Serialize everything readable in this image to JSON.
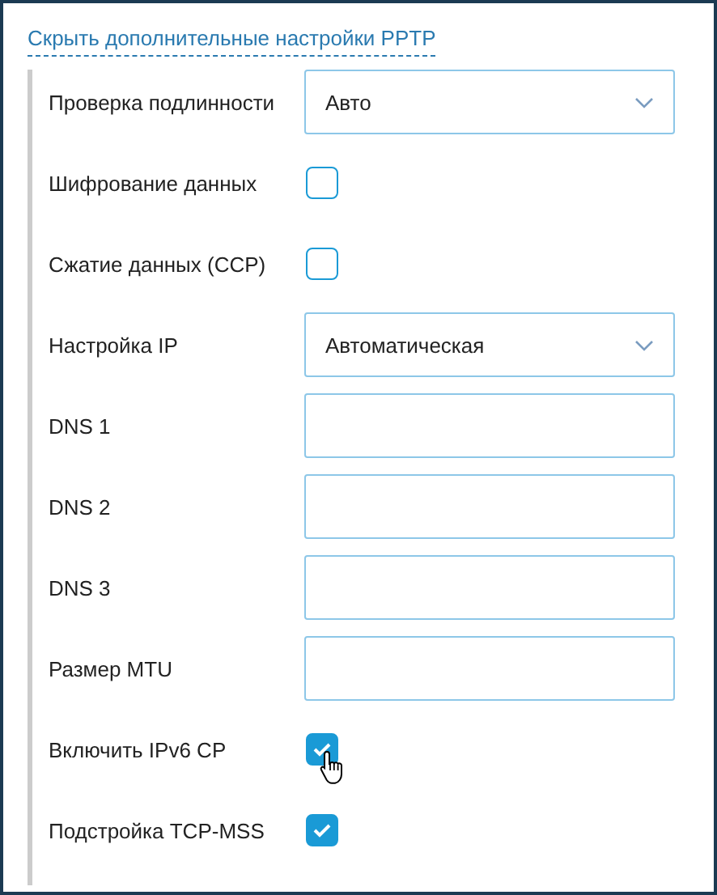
{
  "toggle_link": "Скрыть дополнительные настройки PPTP",
  "fields": [
    {
      "kind": "select",
      "label": "Проверка подлинности",
      "value": "Авто"
    },
    {
      "kind": "checkbox",
      "label": "Шифрование данных",
      "checked": false
    },
    {
      "kind": "checkbox",
      "label": "Сжатие данных (CCP)",
      "checked": false
    },
    {
      "kind": "select",
      "label": "Настройка IP",
      "value": "Автоматическая"
    },
    {
      "kind": "text",
      "label": "DNS 1"
    },
    {
      "kind": "text",
      "label": "DNS 2"
    },
    {
      "kind": "text",
      "label": "DNS 3"
    },
    {
      "kind": "text",
      "label": "Размер MTU"
    },
    {
      "kind": "checkbox",
      "label": "Включить IPv6 CP",
      "checked": true,
      "hovered": true
    },
    {
      "kind": "checkbox",
      "label": "Подстройка TCP-MSS",
      "checked": true
    }
  ]
}
